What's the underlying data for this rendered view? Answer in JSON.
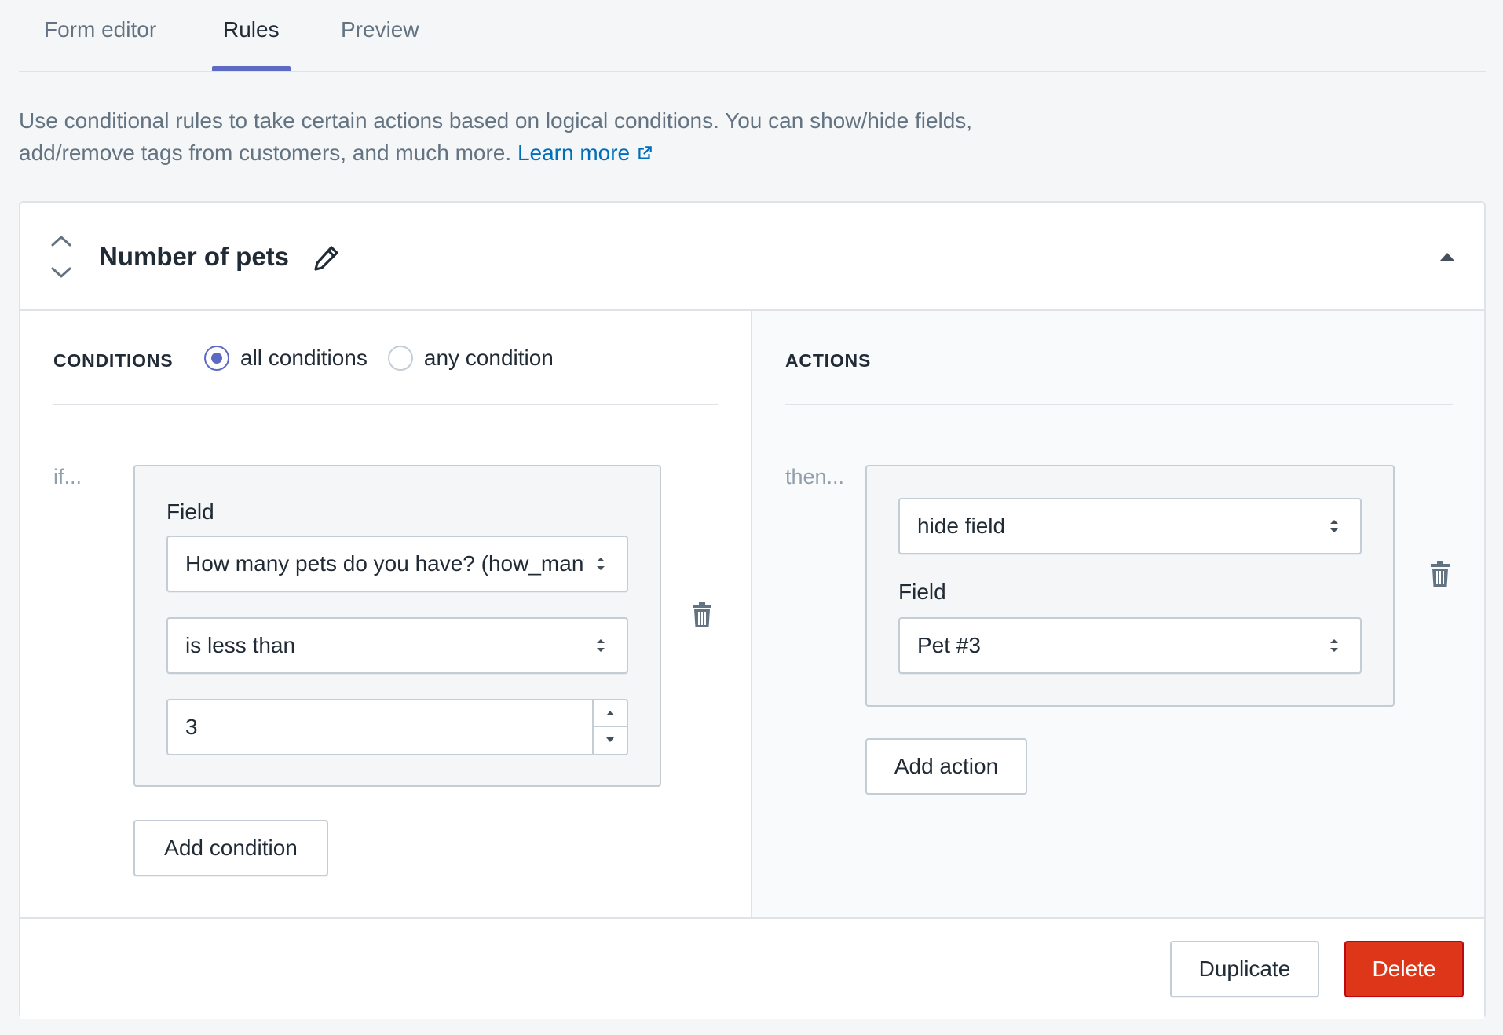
{
  "tabs": [
    {
      "label": "Form editor",
      "active": false
    },
    {
      "label": "Rules",
      "active": true
    },
    {
      "label": "Preview",
      "active": false
    }
  ],
  "description": {
    "text": "Use conditional rules to take certain actions based on logical conditions. You can show/hide fields, add/remove tags from customers, and much more.",
    "link_label": "Learn more",
    "link_icon": "external-link-icon"
  },
  "rule": {
    "title": "Number of pets",
    "icons": {
      "move_up": "chevron-up-icon",
      "move_down": "chevron-down-icon",
      "edit": "pencil-icon",
      "collapse": "caret-up-icon"
    }
  },
  "conditions": {
    "label": "CONDITIONS",
    "options": [
      {
        "label": "all conditions",
        "checked": true
      },
      {
        "label": "any condition",
        "checked": false
      }
    ],
    "if_label": "if...",
    "field_label": "Field",
    "field_value": "How many pets do you have? (how_many_pets)",
    "operator_value": "is less than",
    "comparison_value": "3",
    "add_button": "Add condition",
    "delete_icon": "trash-icon"
  },
  "actions": {
    "label": "ACTIONS",
    "then_label": "then...",
    "action_value": "hide field",
    "field_label": "Field",
    "field_value": "Pet #3",
    "add_button": "Add action",
    "delete_icon": "trash-icon"
  },
  "footer": {
    "duplicate_label": "Duplicate",
    "delete_label": "Delete"
  },
  "colors": {
    "accent": "#5c6ac4",
    "link": "#006fbb",
    "danger": "#de3618",
    "text": "#212b36",
    "muted_text": "#637381"
  }
}
